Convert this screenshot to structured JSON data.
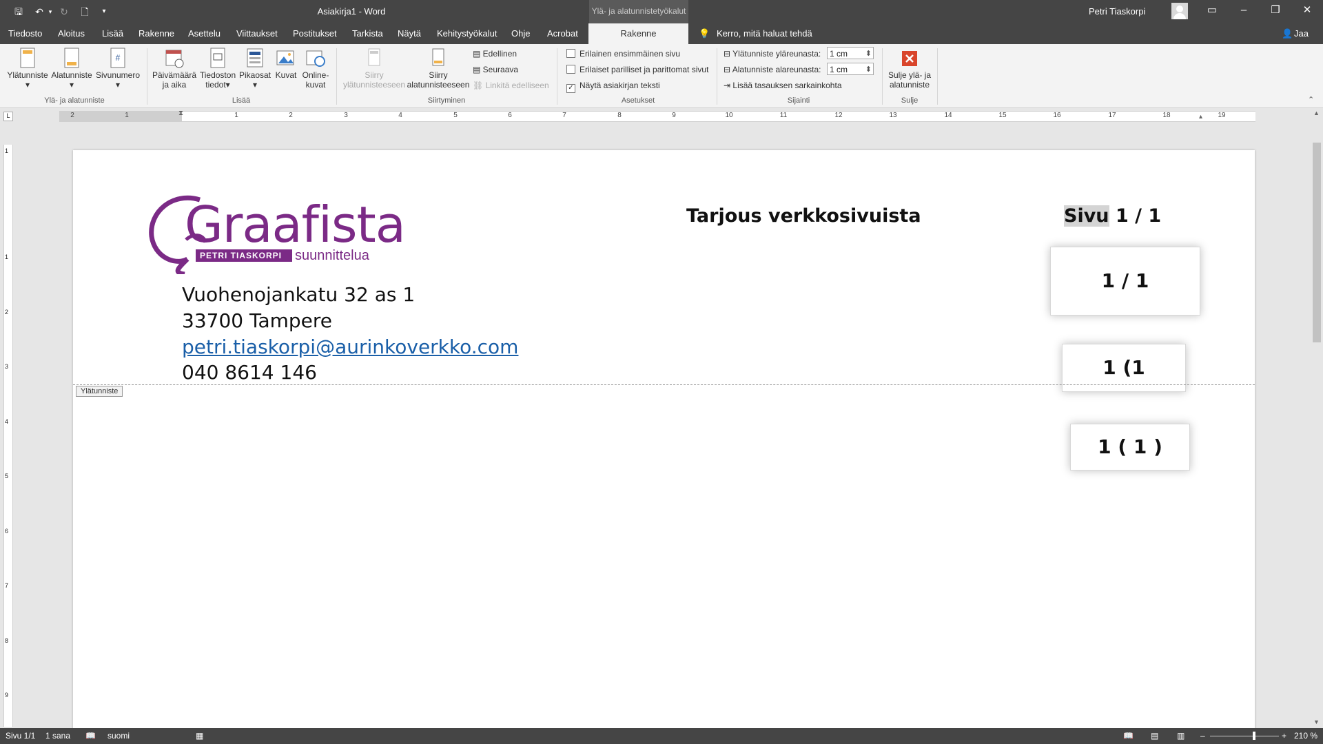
{
  "titlebar": {
    "doc_title": "Asiakirja1 - Word",
    "context_tools": "Ylä- ja alatunnistetyökalut",
    "user_name": "Petri Tiaskorpi"
  },
  "tabs": [
    "Tiedosto",
    "Aloitus",
    "Lisää",
    "Rakenne",
    "Asettelu",
    "Viittaukset",
    "Postitukset",
    "Tarkista",
    "Näytä",
    "Kehitystyökalut",
    "Ohje",
    "Acrobat"
  ],
  "active_tab": "Rakenne",
  "tell_me": "Kerro, mitä haluat tehdä",
  "share": "Jaa",
  "ribbon": {
    "g1": {
      "label": "Ylä- ja alatunniste",
      "b1": "Ylätunniste",
      "b2": "Alatunniste",
      "b3": "Sivunumero"
    },
    "g2": {
      "label": "Lisää",
      "b1a": "Päivämäärä",
      "b1b": "ja aika",
      "b2a": "Tiedoston",
      "b2b": "tiedot",
      "b3": "Pikaosat",
      "b4": "Kuvat",
      "b5a": "Online-",
      "b5b": "kuvat"
    },
    "g3": {
      "label": "Siirtyminen",
      "b1a": "Siirry",
      "b1b": "ylätunnisteeseen",
      "b2a": "Siirry",
      "b2b": "alatunnisteeseen",
      "prev": "Edellinen",
      "next": "Seuraava",
      "link": "Linkitä edelliseen"
    },
    "g4": {
      "label": "Asetukset",
      "o1": "Erilainen ensimmäinen sivu",
      "o2": "Erilaiset parilliset ja parittomat sivut",
      "o3": "Näytä asiakirjan teksti"
    },
    "g5": {
      "label": "Sijainti",
      "header_pos_label": "Ylätunniste yläreunasta:",
      "header_pos": "1 cm",
      "footer_pos_label": "Alatunniste alareunasta:",
      "footer_pos": "1 cm",
      "tab_align": "Lisää tasauksen sarkainkohta"
    },
    "g6": {
      "label": "Sulje",
      "b1a": "Sulje ylä- ja",
      "b1b": "alatunniste"
    }
  },
  "ruler_numbers": [
    "2",
    "1",
    "1",
    "2",
    "3",
    "4",
    "5",
    "6",
    "7",
    "8",
    "9",
    "10",
    "11",
    "12",
    "13",
    "14",
    "15",
    "16",
    "17",
    "18",
    "19"
  ],
  "vruler_numbers": [
    "1",
    "1",
    "2",
    "3",
    "4",
    "5",
    "6",
    "7",
    "8",
    "9"
  ],
  "document": {
    "logo_main": "Graafista",
    "logo_sub1": "PETRI TIASKORPI",
    "logo_sub2": "suunnittelua",
    "address1": "Vuohenojankatu 32 as 1",
    "address2": "33700 Tampere",
    "email": "petri.tiaskorpi@aurinkoverkko.com",
    "phone": "040 8614 146",
    "heading": "Tarjous verkkosivuista",
    "page_word": "Sivu",
    "page_num": "1 / 1",
    "box1": "1 / 1",
    "box2": "1 (1",
    "box3": "1 ( 1 )",
    "header_tag": "Ylätunniste"
  },
  "statusbar": {
    "page": "Sivu 1/1",
    "words": "1 sana",
    "language": "suomi",
    "zoom": "210 %"
  },
  "colors": {
    "titlebar": "#454545",
    "ribbon": "#f3f3f3",
    "logo_purple": "#7b2a86",
    "link_blue": "#1a5fa8",
    "close_red": "#d9452b"
  }
}
